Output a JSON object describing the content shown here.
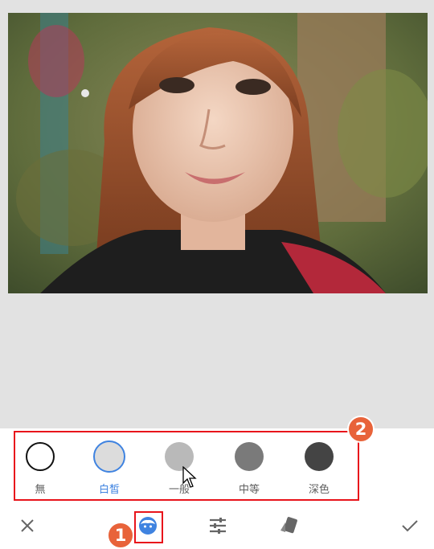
{
  "photo": {
    "description_icon": "portrait-photo"
  },
  "skin_tones": {
    "selected_index": 1,
    "options": [
      {
        "label": "無",
        "color": "#ffffff",
        "border": "#111111"
      },
      {
        "label": "白皙",
        "color": "#dcdcdc",
        "border": "#3f83e0"
      },
      {
        "label": "一般",
        "color": "#b9b9b9",
        "border": "#b9b9b9"
      },
      {
        "label": "中等",
        "color": "#7a7a7a",
        "border": "#7a7a7a"
      },
      {
        "label": "深色",
        "color": "#444444",
        "border": "#444444"
      }
    ]
  },
  "toolbar": {
    "tools": [
      "close-icon",
      "face-icon",
      "tune-sliders-icon",
      "styles-icon",
      "check-icon"
    ],
    "active_tool": "face-icon"
  },
  "annotations": {
    "badge_1": "1",
    "badge_2": "2"
  },
  "colors": {
    "accent": "#3f83e0",
    "highlight": "#e8141b",
    "badge": "#e8633a"
  }
}
